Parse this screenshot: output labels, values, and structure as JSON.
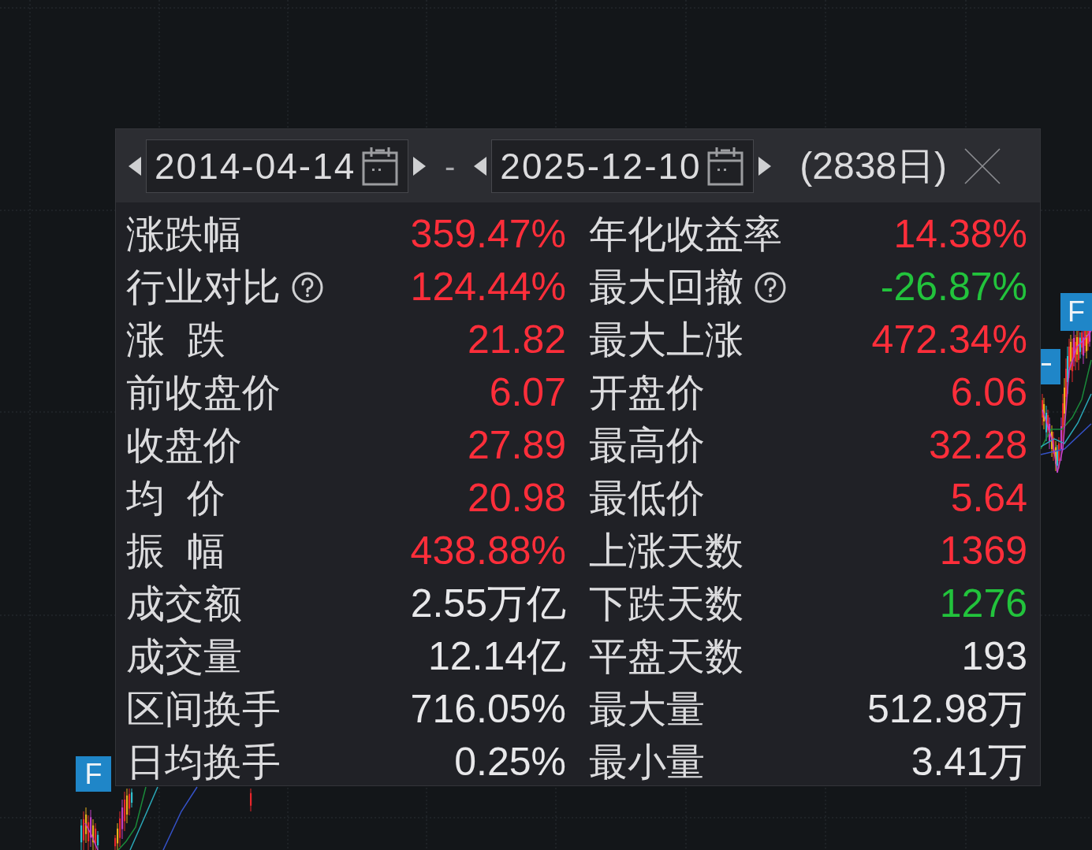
{
  "chart": {
    "markers": [
      {
        "label": "F"
      },
      {
        "label": "F"
      }
    ]
  },
  "panel": {
    "start_date": "2014-04-14",
    "separator": "-",
    "end_date": "2025-12-10",
    "day_count": "(2838日)",
    "stats": [
      {
        "label": "涨跌幅",
        "help": false,
        "value": "359.47%",
        "color": "#ff2e3a"
      },
      {
        "label": "年化收益率",
        "help": false,
        "value": "14.38%",
        "color": "#ff2e3a"
      },
      {
        "label": "行业对比",
        "help": true,
        "value": "124.44%",
        "color": "#ff2e3a"
      },
      {
        "label": "最大回撤",
        "help": true,
        "value": "-26.87%",
        "color": "#22c33c"
      },
      {
        "label": "涨 跌",
        "help": false,
        "value": "21.82",
        "color": "#ff2e3a"
      },
      {
        "label": "最大上涨",
        "help": false,
        "value": "472.34%",
        "color": "#ff2e3a"
      },
      {
        "label": "前收盘价",
        "help": false,
        "value": "6.07",
        "color": "#ff2e3a"
      },
      {
        "label": "开盘价",
        "help": false,
        "value": "6.06",
        "color": "#ff2e3a"
      },
      {
        "label": "收盘价",
        "help": false,
        "value": "27.89",
        "color": "#ff2e3a"
      },
      {
        "label": "最高价",
        "help": false,
        "value": "32.28",
        "color": "#ff2e3a"
      },
      {
        "label": "均 价",
        "help": false,
        "value": "20.98",
        "color": "#ff2e3a"
      },
      {
        "label": "最低价",
        "help": false,
        "value": "5.64",
        "color": "#ff2e3a"
      },
      {
        "label": "振 幅",
        "help": false,
        "value": "438.88%",
        "color": "#ff2e3a"
      },
      {
        "label": "上涨天数",
        "help": false,
        "value": "1369",
        "color": "#ff2e3a"
      },
      {
        "label": "成交额",
        "help": false,
        "value": "2.55万亿",
        "color": "#e8e8ea"
      },
      {
        "label": "下跌天数",
        "help": false,
        "value": "1276",
        "color": "#22c33c"
      },
      {
        "label": "成交量",
        "help": false,
        "value": "12.14亿",
        "color": "#e8e8ea"
      },
      {
        "label": "平盘天数",
        "help": false,
        "value": "193",
        "color": "#e8e8ea"
      },
      {
        "label": "区间换手",
        "help": false,
        "value": "716.05%",
        "color": "#e8e8ea"
      },
      {
        "label": "最大量",
        "help": false,
        "value": "512.98万",
        "color": "#e8e8ea"
      },
      {
        "label": "日均换手",
        "help": false,
        "value": "0.25%",
        "color": "#e8e8ea"
      },
      {
        "label": "最小量",
        "help": false,
        "value": "3.41万",
        "color": "#e8e8ea"
      }
    ]
  }
}
